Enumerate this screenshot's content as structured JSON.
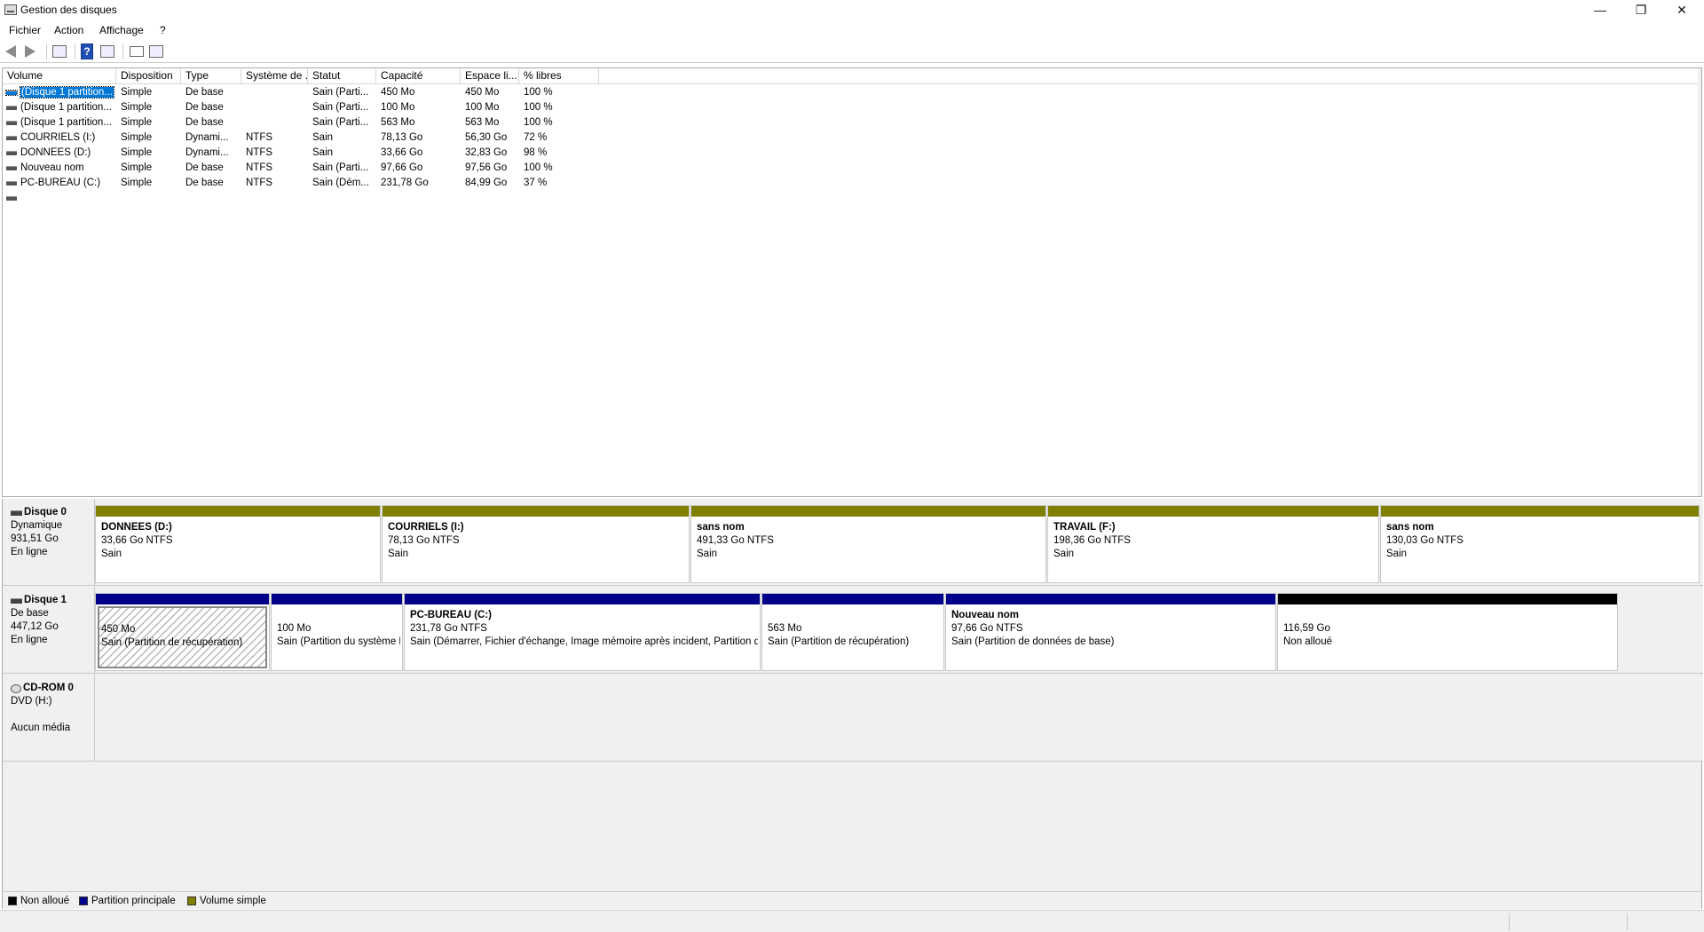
{
  "window": {
    "title": "Gestion des disques",
    "minimize": "—",
    "maximize": "❐",
    "close": "✕"
  },
  "menu": [
    "Fichier",
    "Action",
    "Affichage",
    "?"
  ],
  "toolbar": {
    "help": "?"
  },
  "table": {
    "columns": [
      "Volume",
      "Disposition",
      "Type",
      "Système de ...",
      "Statut",
      "Capacité",
      "Espace li...",
      "% libres"
    ],
    "rows": [
      [
        "(Disque 1 partition...",
        "Simple",
        "De base",
        "",
        "Sain (Parti...",
        "450 Mo",
        "450 Mo",
        "100 %"
      ],
      [
        "(Disque 1 partition...",
        "Simple",
        "De base",
        "",
        "Sain (Parti...",
        "100 Mo",
        "100 Mo",
        "100 %"
      ],
      [
        "(Disque 1 partition...",
        "Simple",
        "De base",
        "",
        "Sain (Parti...",
        "563 Mo",
        "563 Mo",
        "100 %"
      ],
      [
        "COURRIELS (I:)",
        "Simple",
        "Dynami...",
        "NTFS",
        "Sain",
        "78,13 Go",
        "56,30 Go",
        "72 %"
      ],
      [
        "DONNEES (D:)",
        "Simple",
        "Dynami...",
        "NTFS",
        "Sain",
        "33,66 Go",
        "32,83 Go",
        "98 %"
      ],
      [
        "Nouveau nom",
        "Simple",
        "De base",
        "NTFS",
        "Sain (Parti...",
        "97,66 Go",
        "97,56 Go",
        "100 %"
      ],
      [
        "PC-BUREAU (C:)",
        "Simple",
        "De base",
        "NTFS",
        "Sain (Dém...",
        "231,78 Go",
        "84,99 Go",
        "37 %"
      ],
      [
        "",
        "",
        "",
        "",
        "",
        "",
        "",
        ""
      ]
    ]
  },
  "disks": [
    {
      "name": "Disque 0",
      "type": "Dynamique",
      "size": "931,51 Go",
      "status": "En ligne",
      "partitions": [
        {
          "name": "DONNEES  (D:)",
          "size": "33,66 Go NTFS",
          "status": "Sain",
          "bar": "#808000"
        },
        {
          "name": "COURRIELS  (I:)",
          "size": "78,13 Go NTFS",
          "status": "Sain",
          "bar": "#808000"
        },
        {
          "name": "sans nom",
          "size": "491,33 Go NTFS",
          "status": "Sain",
          "bar": "#808000"
        },
        {
          "name": "TRAVAIL  (F:)",
          "size": "198,36 Go NTFS",
          "status": "Sain",
          "bar": "#808000"
        },
        {
          "name": "sans nom",
          "size": "130,03 Go NTFS",
          "status": "Sain",
          "bar": "#808000"
        }
      ]
    },
    {
      "name": "Disque 1",
      "type": "De base",
      "size": "447,12 Go",
      "status": "En ligne",
      "partitions": [
        {
          "name": "",
          "size": "450 Mo",
          "status": "Sain (Partition de récupération)",
          "bar": "#00008b"
        },
        {
          "name": "",
          "size": "100 Mo",
          "status": "Sain (Partition du système EFI)",
          "bar": "#00008b"
        },
        {
          "name": "PC-BUREAU  (C:)",
          "size": "231,78 Go NTFS",
          "status": "Sain (Démarrer, Fichier d'échange, Image mémoire après incident, Partition de données de base)",
          "bar": "#00008b"
        },
        {
          "name": "",
          "size": "563 Mo",
          "status": "Sain (Partition de récupération)",
          "bar": "#00008b"
        },
        {
          "name": "Nouveau nom",
          "size": "97,66 Go NTFS",
          "status": "Sain (Partition de données de base)",
          "bar": "#00008b"
        },
        {
          "name": "",
          "size": "116,59 Go",
          "status": "Non alloué",
          "bar": "#000000"
        }
      ]
    },
    {
      "name": "CD-ROM 0",
      "type": "DVD (H:)",
      "size": "",
      "status": "Aucun média",
      "partitions": []
    }
  ],
  "legend": [
    {
      "label": "Non alloué",
      "color": "#000000"
    },
    {
      "label": "Partition principale",
      "color": "#00008b"
    },
    {
      "label": "Volume simple",
      "color": "#808000"
    }
  ]
}
